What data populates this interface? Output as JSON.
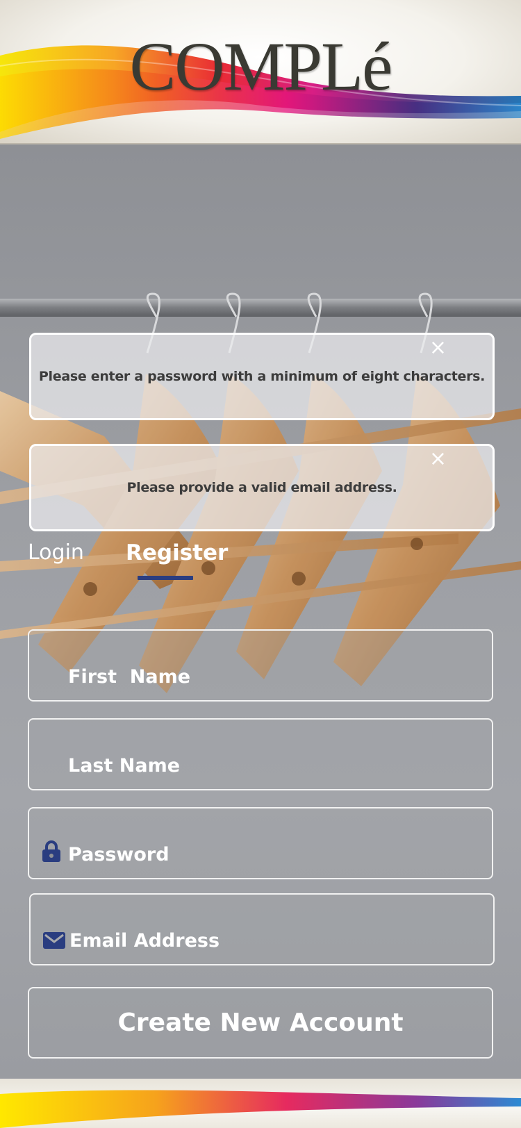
{
  "header": {
    "logo_text": "COMPLé"
  },
  "alerts": [
    {
      "message": "Please  enter a password with a minimum of eight characters.",
      "close_label": "×"
    },
    {
      "message": "Please provide a valid email address.",
      "close_label": "×"
    }
  ],
  "tabs": {
    "login_label": "Login",
    "register_label": "Register",
    "active": "Register"
  },
  "form": {
    "first_name_placeholder": "First  Name",
    "last_name_placeholder": "Last Name",
    "password_placeholder": "Password",
    "email_placeholder": "Email Address",
    "submit_label": "Create New Account"
  },
  "icons": {
    "password_icon": "lock-icon",
    "email_icon": "envelope-icon",
    "close_icon": "close-icon"
  },
  "colors": {
    "accent": "#2a3d80",
    "text_on_photo": "#ffffff",
    "alert_text": "#3c3c3c"
  }
}
